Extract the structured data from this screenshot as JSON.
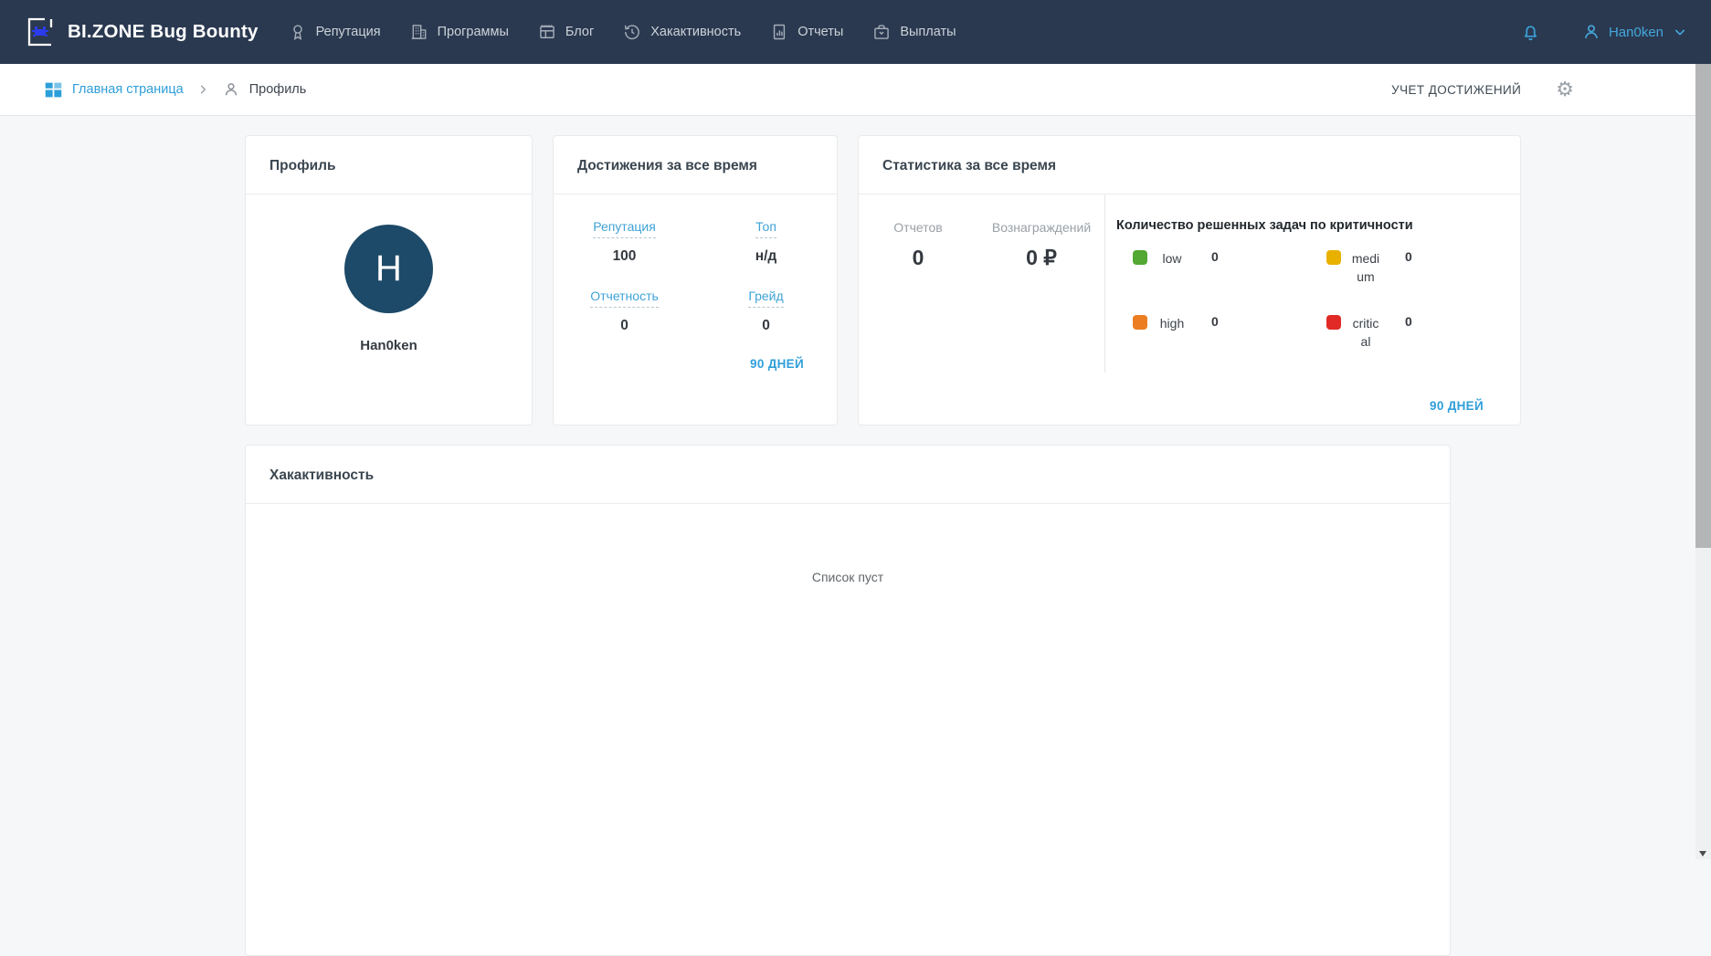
{
  "navbar": {
    "brand": "BI.ZONE Bug Bounty",
    "items": [
      {
        "label": "Репутация",
        "icon": "medal-icon"
      },
      {
        "label": "Программы",
        "icon": "building-icon"
      },
      {
        "label": "Блог",
        "icon": "newspaper-icon"
      },
      {
        "label": "Хакактивность",
        "icon": "history-icon"
      },
      {
        "label": "Отчеты",
        "icon": "report-icon"
      },
      {
        "label": "Выплаты",
        "icon": "briefcase-icon"
      }
    ],
    "username": "Han0ken"
  },
  "breadcrumb": {
    "home_label": "Главная страница",
    "current_label": "Профиль",
    "right_label": "УЧЕТ ДОСТИЖЕНИЙ"
  },
  "profile_card": {
    "title": "Профиль",
    "avatar_letter": "H",
    "username": "Han0ken"
  },
  "achievements_card": {
    "title": "Достижения за все время",
    "stats": [
      {
        "label": "Репутация",
        "value": "100"
      },
      {
        "label": "Топ",
        "value": "н/д"
      },
      {
        "label": "Отчетность",
        "value": "0"
      },
      {
        "label": "Грейд",
        "value": "0"
      }
    ],
    "period_link": "90 ДНЕЙ"
  },
  "statistics_card": {
    "title": "Статистика за все время",
    "stats": [
      {
        "label": "Отчетов",
        "value": "0"
      },
      {
        "label": "Вознаграждений",
        "value": "0 ₽"
      }
    ],
    "severity_title": "Количество решенных задач по критичности",
    "severity": [
      {
        "label": "low",
        "value": "0",
        "color": "#52a832"
      },
      {
        "label": "medium",
        "value": "0",
        "color": "#e8b100"
      },
      {
        "label": "high",
        "value": "0",
        "color": "#ed7d21"
      },
      {
        "label": "critical",
        "value": "0",
        "color": "#e12a26"
      }
    ],
    "period_link": "90 ДНЕЙ"
  },
  "activity_card": {
    "title": "Хакактивность",
    "empty_text": "Список пуст"
  },
  "colors": {
    "navbar_bg": "#2a3950",
    "accent_blue": "#38a1da",
    "avatar_bg": "#1d4a68",
    "logo_bug_blue": "#2c3bee"
  }
}
